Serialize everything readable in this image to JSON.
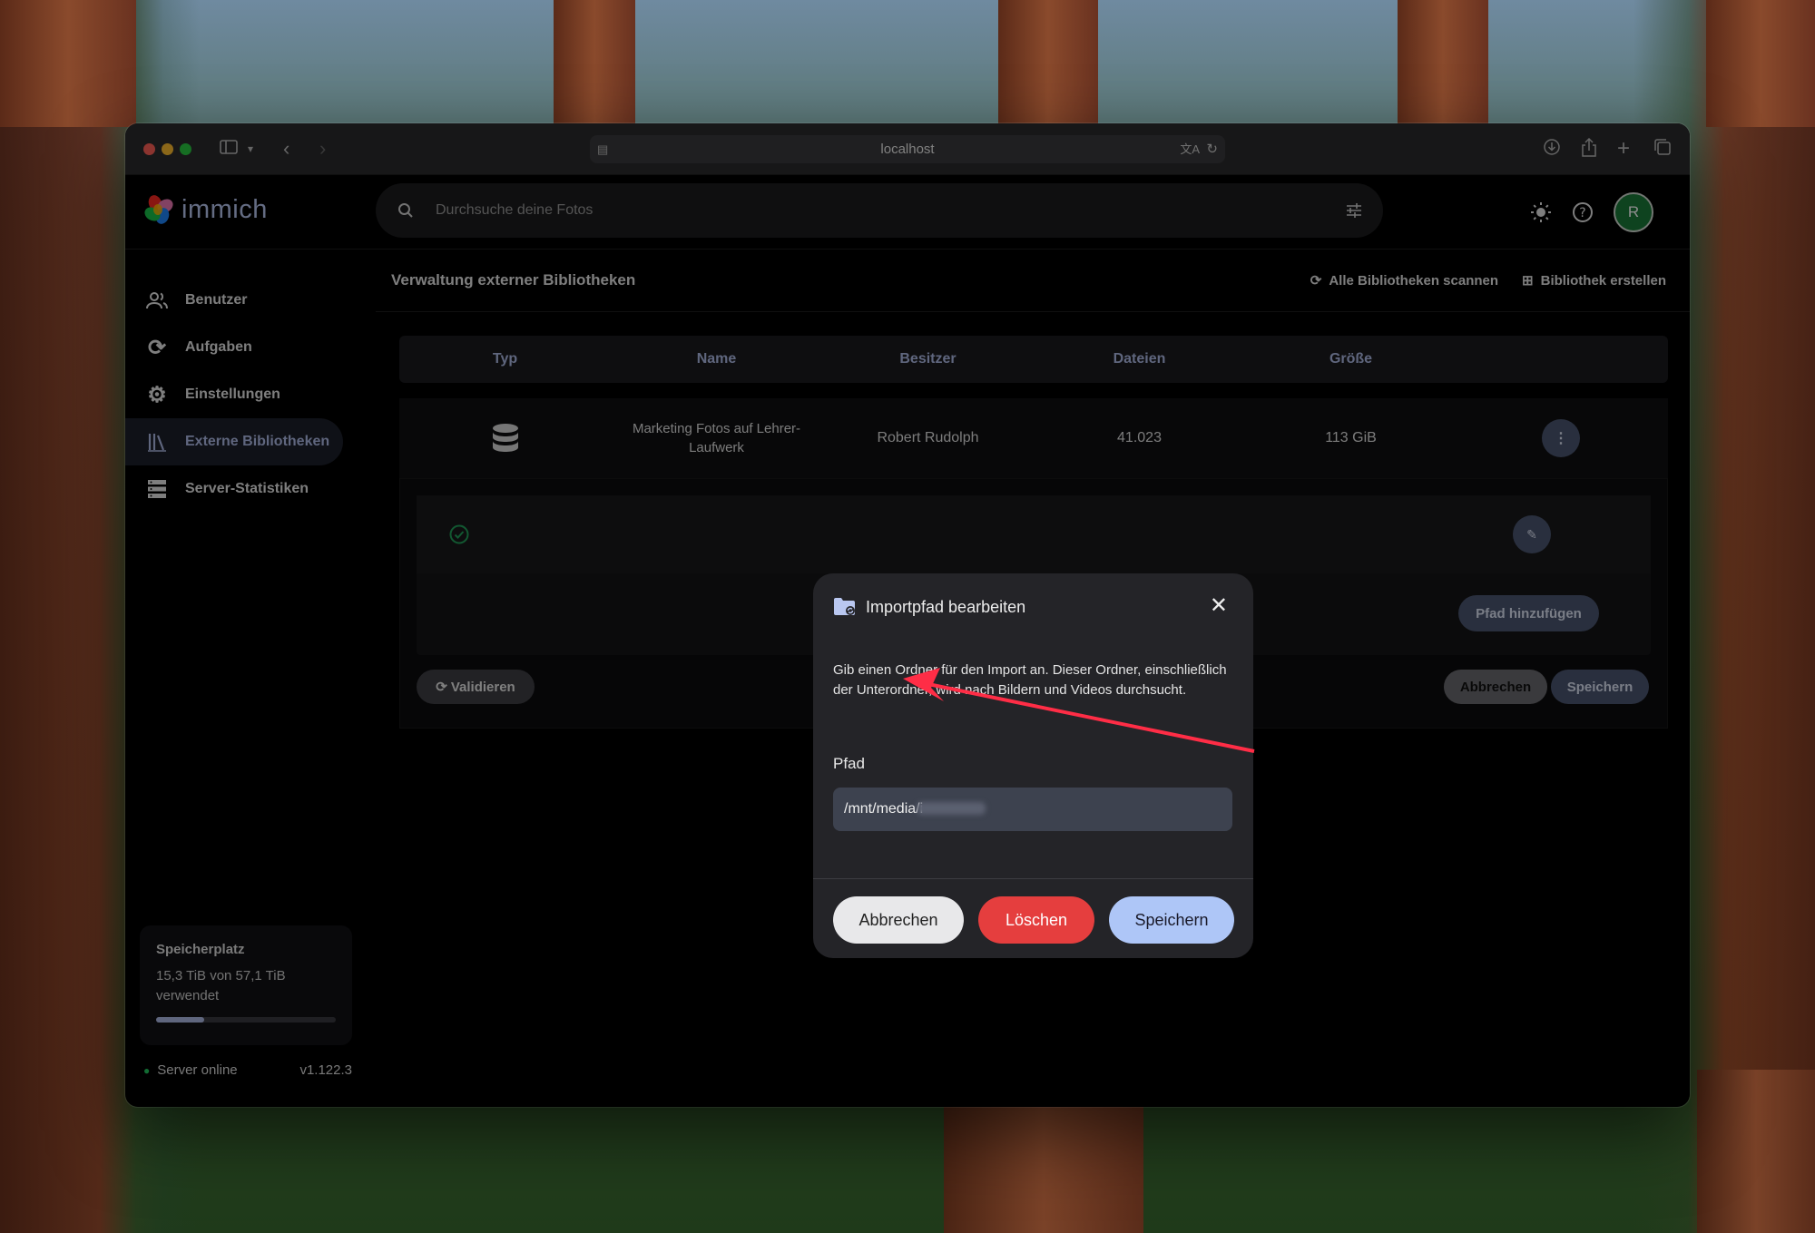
{
  "browser": {
    "url": "localhost",
    "icons": [
      "sidebar-icon",
      "chevron-down-icon",
      "back-icon",
      "forward-icon",
      "download-icon",
      "share-icon",
      "new-tab-icon",
      "tabs-overview-icon"
    ]
  },
  "app": {
    "name": "immich",
    "search_placeholder": "Durchsuche deine Fotos",
    "avatar_initial": "R",
    "accent_color": "#aebbe6"
  },
  "sidebar": {
    "items": [
      {
        "label": "Benutzer",
        "icon": "users-icon"
      },
      {
        "label": "Aufgaben",
        "icon": "sync-icon"
      },
      {
        "label": "Einstellungen",
        "icon": "gear-icon"
      },
      {
        "label": "Externe Bibliotheken",
        "icon": "library-icon",
        "active": true
      },
      {
        "label": "Server-Statistiken",
        "icon": "server-icon"
      }
    ],
    "storage": {
      "title": "Speicherplatz",
      "usage": "15,3 TiB von 57,1 TiB verwendet",
      "used_fraction": 0.27
    },
    "server_status": "Server online",
    "version": "v1.122.3"
  },
  "page": {
    "title": "Verwaltung externer Bibliotheken",
    "scan_all": "Alle Bibliotheken scannen",
    "create_library": "Bibliothek erstellen"
  },
  "table": {
    "headers": [
      "Typ",
      "Name",
      "Besitzer",
      "Dateien",
      "Größe"
    ],
    "row": {
      "name": "Marketing Fotos auf Lehrer-Laufwerk",
      "owner": "Robert Rudolph",
      "files": "41.023",
      "size": "113 GiB"
    }
  },
  "expanded": {
    "add_path": "Pfad hinzufügen",
    "validate": "Validieren",
    "cancel": "Abbrechen",
    "save": "Speichern"
  },
  "modal": {
    "title": "Importpfad bearbeiten",
    "description": "Gib einen Ordner für den Import an. Dieser Ordner, einschließlich der Unterordner, wird nach Bildern und Videos durchsucht.",
    "field_label": "Pfad",
    "field_value": "/mnt/media/i",
    "cancel": "Abbrechen",
    "delete": "Löschen",
    "save": "Speichern",
    "colors": {
      "delete": "#e53e3e",
      "save": "#aec6f7",
      "cancel": "#e8e8ea"
    }
  }
}
